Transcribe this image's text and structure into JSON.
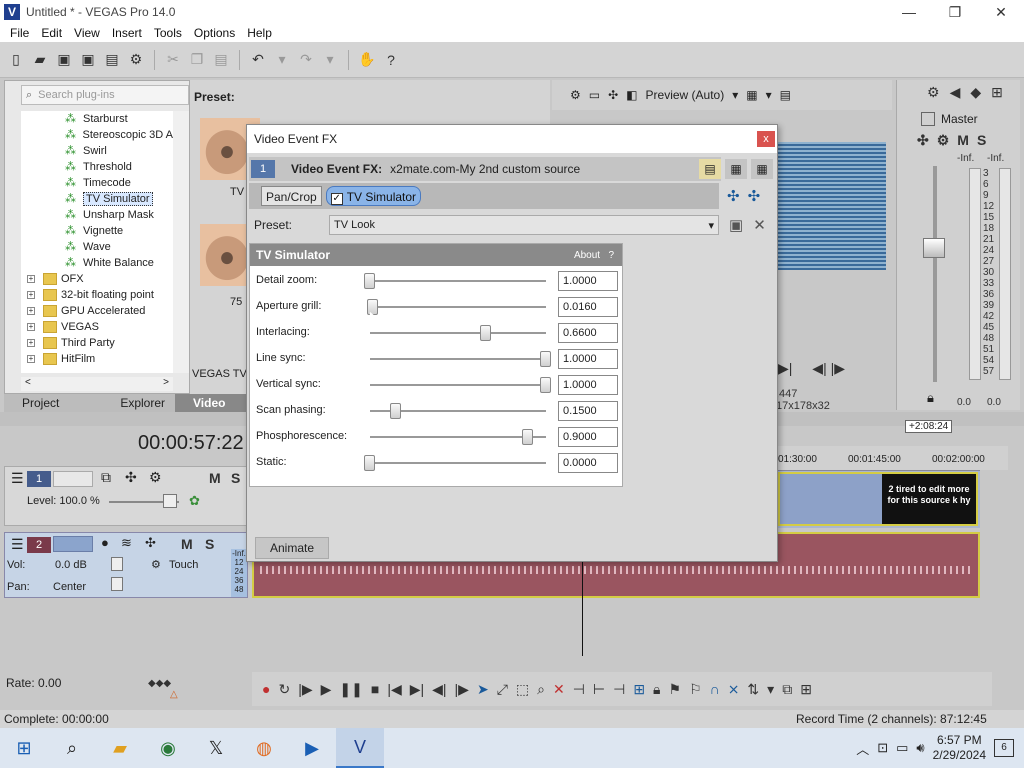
{
  "window": {
    "title": "Untitled * - VEGAS Pro 14.0",
    "minimize": "—",
    "maximize": "❐",
    "close": "✕"
  },
  "menu": [
    "File",
    "Edit",
    "View",
    "Insert",
    "Tools",
    "Options",
    "Help"
  ],
  "plugins": {
    "search_placeholder": "Search plug-ins",
    "items": [
      {
        "label": "Starburst",
        "type": "fx"
      },
      {
        "label": "Stereoscopic 3D A",
        "type": "fx"
      },
      {
        "label": "Swirl",
        "type": "fx"
      },
      {
        "label": "Threshold",
        "type": "fx"
      },
      {
        "label": "Timecode",
        "type": "fx"
      },
      {
        "label": "TV Simulator",
        "type": "fx",
        "selected": true
      },
      {
        "label": "Unsharp Mask",
        "type": "fx"
      },
      {
        "label": "Vignette",
        "type": "fx"
      },
      {
        "label": "Wave",
        "type": "fx"
      },
      {
        "label": "White Balance",
        "type": "fx"
      },
      {
        "label": "OFX",
        "type": "folder"
      },
      {
        "label": "32-bit floating point",
        "type": "folder"
      },
      {
        "label": "GPU Accelerated",
        "type": "folder"
      },
      {
        "label": "VEGAS",
        "type": "folder"
      },
      {
        "label": "Third Party",
        "type": "folder"
      },
      {
        "label": "HitFilm",
        "type": "folder"
      }
    ],
    "preset_label": "Preset:",
    "thumb1_label": "TV",
    "thumb2_label": "75"
  },
  "tabs": [
    "Project Media",
    "Explorer",
    "Video FX"
  ],
  "partial_label": "VEGAS TV S",
  "preview": {
    "mode": "Preview (Auto)",
    "info_line1": ",447",
    "info_line2": "17x178x32"
  },
  "master": {
    "title": "Master",
    "scale": [
      "-Inf.",
      "-Inf.",
      "3",
      "6",
      "9",
      "12",
      "15",
      "18",
      "21",
      "24",
      "27",
      "30",
      "33",
      "36",
      "39",
      "42",
      "45",
      "48",
      "51",
      "54",
      "57"
    ],
    "bottom_left": "0.0",
    "bottom_right": "0.0"
  },
  "dialog": {
    "title": "Video Event FX",
    "close": "x",
    "chain_number": "1",
    "chain_label": "Video Event FX:",
    "chain_source": "x2mate.com-My 2nd custom source",
    "chain_buttons": [
      "Pan/Crop",
      "TV Simulator"
    ],
    "preset_label": "Preset:",
    "preset_value": "TV Look",
    "panel_title": "TV Simulator",
    "about": "About",
    "help": "?",
    "params": [
      {
        "label": "Detail zoom:",
        "value": "1.0000",
        "pos": 0.0
      },
      {
        "label": "Aperture grill:",
        "value": "0.0160",
        "pos": 0.016
      },
      {
        "label": "Interlacing:",
        "value": "0.6600",
        "pos": 0.66
      },
      {
        "label": "Line sync:",
        "value": "1.0000",
        "pos": 1.0
      },
      {
        "label": "Vertical sync:",
        "value": "1.0000",
        "pos": 1.0
      },
      {
        "label": "Scan phasing:",
        "value": "0.1500",
        "pos": 0.15
      },
      {
        "label": "Phosphorescence:",
        "value": "0.9000",
        "pos": 0.9
      },
      {
        "label": "Static:",
        "value": "0.0000",
        "pos": 0.0
      }
    ],
    "animate": "Animate"
  },
  "timeline": {
    "timecode": "00:00:57:22",
    "badge": "+2:08:24",
    "ruler": [
      "01:30:00",
      "00:01:45:00",
      "00:02:00:00"
    ],
    "track1": {
      "number": "1",
      "level": "Level: 100.0 %",
      "m": "M",
      "s": "S"
    },
    "track2": {
      "number": "2",
      "vol": "Vol:",
      "vol_value": "0.0 dB",
      "pan": "Pan:",
      "pan_value": "Center",
      "touch": "Touch",
      "m": "M",
      "s": "S",
      "meter": [
        "-Inf.",
        "12",
        "24",
        "36",
        "48"
      ]
    },
    "clip_text": "2 tired to edit more for this source k hy"
  },
  "bottom": {
    "rate": "Rate: 0.00",
    "complete": "Complete: 00:00:00",
    "record_time": "Record Time (2 channels): 87:12:45"
  },
  "taskbar": {
    "time": "6:57 PM",
    "date": "2/29/2024",
    "notifications": "6"
  }
}
